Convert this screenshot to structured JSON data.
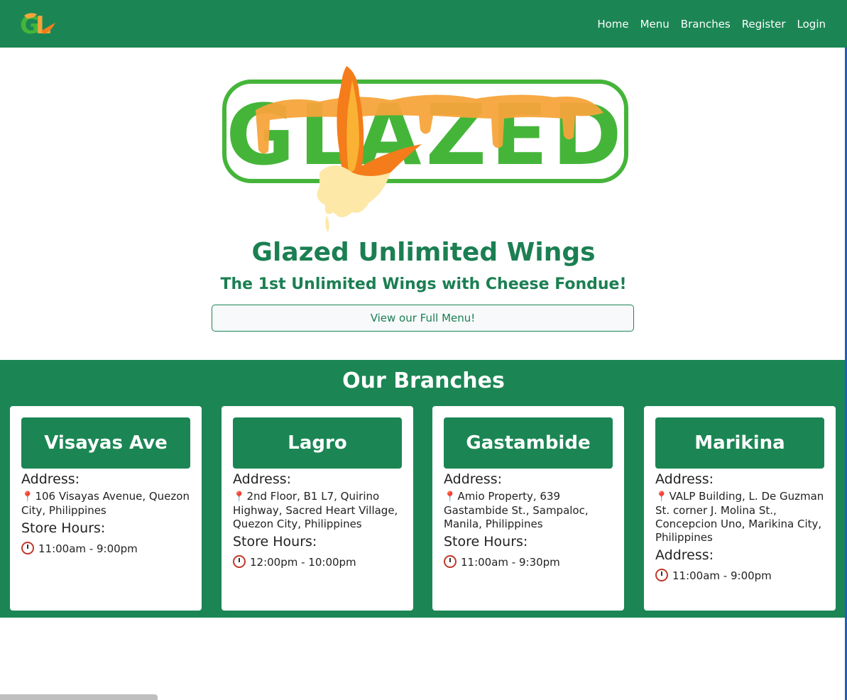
{
  "nav": {
    "logo_text": "GL",
    "links": [
      "Home",
      "Menu",
      "Branches",
      "Register",
      "Login"
    ]
  },
  "hero": {
    "logo_text": "GLAZED",
    "title": "Glazed Unlimited Wings",
    "subtitle": "The 1st Unlimited Wings with Cheese Fondue!",
    "menu_button": "View our Full Menu!"
  },
  "branches": {
    "title": "Our Branches",
    "cards": [
      {
        "name": "Visayas Ave",
        "address_label": "Address:",
        "address": "106 Visayas Avenue, Quezon City, Philippines",
        "hours_label": "Store Hours:",
        "hours": "11:00am - 9:00pm"
      },
      {
        "name": "Lagro",
        "address_label": "Address:",
        "address": "2nd Floor, B1 L7, Quirino Highway, Sacred Heart Village, Quezon City, Philippines",
        "hours_label": "Store Hours:",
        "hours": "12:00pm - 10:00pm"
      },
      {
        "name": "Gastambide",
        "address_label": "Address:",
        "address": "Amio Property, 639 Gastambide St., Sampaloc, Manila, Philippines",
        "hours_label": "Store Hours:",
        "hours": "11:00am - 9:30pm"
      },
      {
        "name": "Marikina",
        "address_label": "Address:",
        "address": "VALP Building, L. De Guzman St. corner J. Molina St., Concepcion Uno, Marikina City, Philippines",
        "hours_label": "Address:",
        "hours": "11:00am - 9:00pm"
      }
    ]
  },
  "colors": {
    "brand_green": "#1b8654",
    "logo_green": "#45b53a",
    "glaze_orange": "#f5a43a",
    "flame_orange": "#f47c1a"
  }
}
